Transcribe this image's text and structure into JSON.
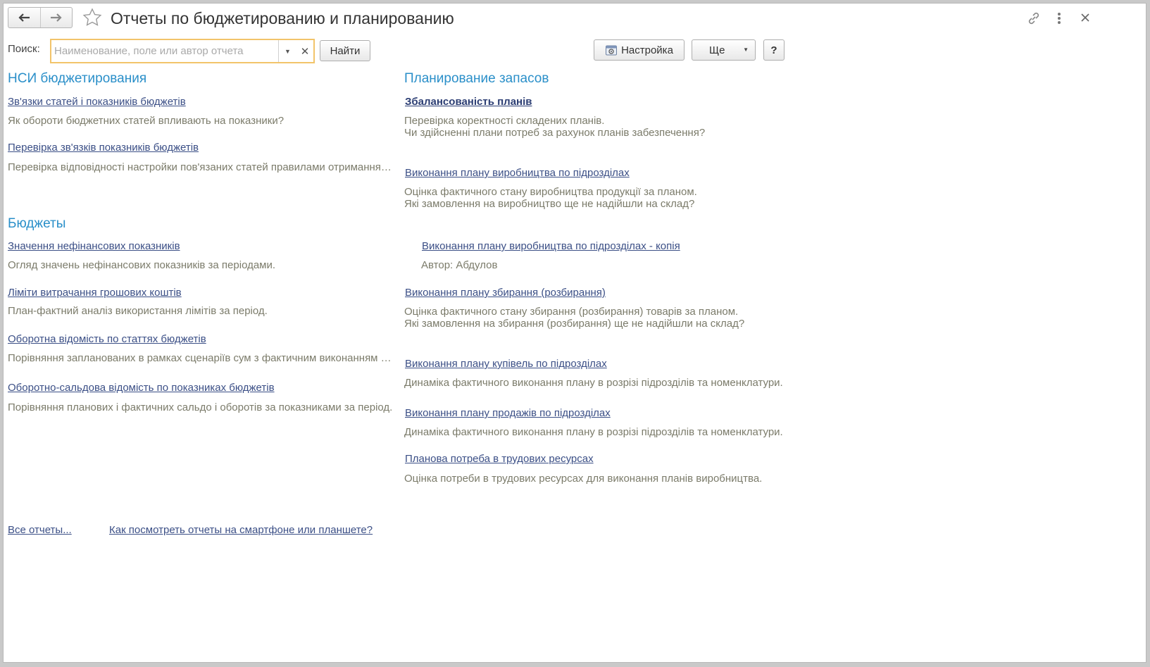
{
  "window": {
    "title": "Отчеты по бюджетированию и планированию"
  },
  "search": {
    "label": "Поиск:",
    "placeholder": "Наименование, поле или автор отчета",
    "value": "",
    "find_button": "Найти"
  },
  "toolbar": {
    "settings_label": "Настройка",
    "more_label": "Ще",
    "help_label": "?"
  },
  "left_sections": [
    {
      "title": "НСИ бюджетирования",
      "items": [
        {
          "link": "Зв'язки статей і показників бюджетів",
          "desc": "Як обороти бюджетних статей впливають на показники?"
        },
        {
          "link": "Перевірка зв'язків показників бюджетів",
          "desc": "Перевірка відповідності настройки пов'язаних статей правилами отримання даних"
        }
      ]
    },
    {
      "title": "Бюджеты",
      "items": [
        {
          "link": "Значення нефінансових показників",
          "desc": "Огляд значень нефінансових показників за періодами."
        },
        {
          "link": "Ліміти витрачання грошових коштів",
          "desc": "План-фактний аналіз використання лімітів за період."
        },
        {
          "link": "Оборотна відомість по статтях бюджетів",
          "desc": "Порівняння запланованих в рамках сценаріїв сум з фактичним виконанням за період"
        },
        {
          "link": "Оборотно-сальдова відомість по показниках бюджетів",
          "desc": "Порівняння планових і фактичних сальдо і оборотів за показниками за період."
        }
      ]
    }
  ],
  "right_section": {
    "title": "Планирование запасов",
    "items": [
      {
        "link": "Збалансованість планів",
        "desc1": "Перевірка коректності складених планів.",
        "desc2": "Чи здійсненні плани потреб за рахунок планів забезпечення?"
      },
      {
        "link": "Виконання плану виробництва по підрозділах",
        "desc1": "Оцінка фактичного стану виробництва продукції за планом.",
        "desc2": "Які замовлення на виробництво ще не надійшли на склад?"
      },
      {
        "link": "Виконання плану виробництва по підрозділах - копія",
        "desc1": "Автор: Абдулов"
      },
      {
        "link": "Виконання плану збирання (розбирання)",
        "desc1": "Оцінка фактичного стану збирання (розбирання) товарів за планом.",
        "desc2": "Які замовлення на збирання (розбирання) ще не надійшли на склад?"
      },
      {
        "link": "Виконання плану купівель по підрозділах",
        "desc1": "Динаміка фактичного виконання плану в розрізі підрозділів та номенклатури."
      },
      {
        "link": "Виконання плану продажів по підрозділах",
        "desc1": "Динаміка фактичного виконання плану в розрізі підрозділів та номенклатури."
      },
      {
        "link": "Планова потреба в трудових ресурсах",
        "desc1": "Оцінка потреби в трудових ресурсах для виконання планів виробництва."
      }
    ]
  },
  "footer": {
    "all_reports": "Все отчеты...",
    "mobile_help": "Как посмотреть отчеты на смартфоне или планшете?"
  },
  "colors": {
    "section_title": "#2a8fc9",
    "link": "#3b4f86",
    "description": "#7b7b6a",
    "search_focus": "#f2c46a"
  },
  "icons": [
    "back-arrow-icon",
    "forward-arrow-icon",
    "star-icon",
    "link-icon",
    "more-vertical-icon",
    "close-icon",
    "settings-icon",
    "dropdown-icon",
    "clear-icon"
  ]
}
